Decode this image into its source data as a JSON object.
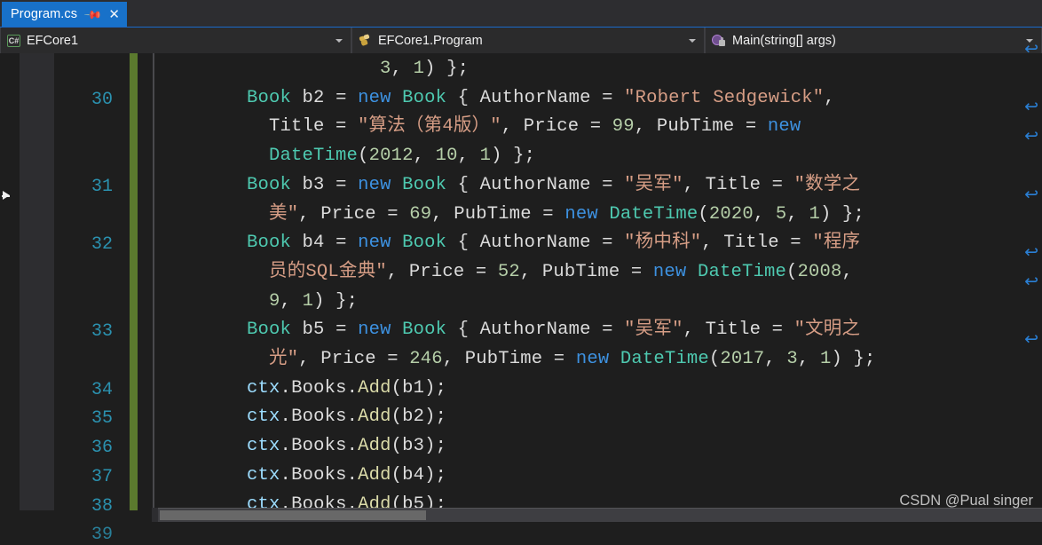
{
  "window": {
    "title": "Program.cs",
    "theme": "visual-studio-dark"
  },
  "tab": {
    "label": "Program.cs",
    "pin_icon": "pin-icon",
    "close_icon": "close-icon",
    "active_color": "#1871c9"
  },
  "navbar": {
    "project": {
      "label": "EFCore1",
      "icon": "csharp-project-icon"
    },
    "type": {
      "label": "EFCore1.Program",
      "icon": "class-icon"
    },
    "member": {
      "label": "Main(string[] args)",
      "icon": "method-private-icon"
    }
  },
  "editor": {
    "change_bar_color": "#5b7a2e",
    "linenumber_color": "#2b91af",
    "wrap_arrow_glyph": "↩",
    "line_numbers": [
      "30",
      "31",
      "32",
      "33",
      "34",
      "35",
      "36",
      "37",
      "38"
    ],
    "lines": [
      {
        "num": "",
        "text": "                 3, 1) };",
        "tokens": [
          {
            "t": "                    ",
            "c": "t-plain"
          },
          {
            "t": "3",
            "c": "t-num"
          },
          {
            "t": ", ",
            "c": "t-punct"
          },
          {
            "t": "1",
            "c": "t-num"
          },
          {
            "t": ") };",
            "c": "t-punct"
          }
        ]
      },
      {
        "num": "30",
        "text": "        Book b2 = new Book { AuthorName = \"Robert Sedgewick\",",
        "tokens": [
          {
            "t": "        ",
            "c": "t-plain"
          },
          {
            "t": "Book",
            "c": "t-type"
          },
          {
            "t": " b2 ",
            "c": "t-plain"
          },
          {
            "t": "= ",
            "c": "t-punct"
          },
          {
            "t": "new",
            "c": "t-kw"
          },
          {
            "t": " ",
            "c": "t-plain"
          },
          {
            "t": "Book",
            "c": "t-type"
          },
          {
            "t": " { AuthorName = ",
            "c": "t-plain"
          },
          {
            "t": "\"Robert Sedgewick\"",
            "c": "t-str"
          },
          {
            "t": ",",
            "c": "t-punct"
          }
        ]
      },
      {
        "num": "",
        "text": "          Title = \"算法（第4版）\", Price = 99, PubTime = new",
        "tokens": [
          {
            "t": "          Title = ",
            "c": "t-plain"
          },
          {
            "t": "\"算法（第4版）\"",
            "c": "t-str"
          },
          {
            "t": ", Price = ",
            "c": "t-plain"
          },
          {
            "t": "99",
            "c": "t-num"
          },
          {
            "t": ", PubTime = ",
            "c": "t-plain"
          },
          {
            "t": "new",
            "c": "t-kw"
          }
        ]
      },
      {
        "num": "",
        "text": "          DateTime(2012, 10, 1) };",
        "tokens": [
          {
            "t": "          ",
            "c": "t-plain"
          },
          {
            "t": "DateTime",
            "c": "t-type"
          },
          {
            "t": "(",
            "c": "t-punct"
          },
          {
            "t": "2012",
            "c": "t-num"
          },
          {
            "t": ", ",
            "c": "t-punct"
          },
          {
            "t": "10",
            "c": "t-num"
          },
          {
            "t": ", ",
            "c": "t-punct"
          },
          {
            "t": "1",
            "c": "t-num"
          },
          {
            "t": ") };",
            "c": "t-punct"
          }
        ]
      },
      {
        "num": "31",
        "text": "        Book b3 = new Book { AuthorName = \"吴军\", Title = \"数学之",
        "tokens": [
          {
            "t": "        ",
            "c": "t-plain"
          },
          {
            "t": "Book",
            "c": "t-type"
          },
          {
            "t": " b3 ",
            "c": "t-plain"
          },
          {
            "t": "= ",
            "c": "t-punct"
          },
          {
            "t": "new",
            "c": "t-kw"
          },
          {
            "t": " ",
            "c": "t-plain"
          },
          {
            "t": "Book",
            "c": "t-type"
          },
          {
            "t": " { AuthorName = ",
            "c": "t-plain"
          },
          {
            "t": "\"吴军\"",
            "c": "t-str"
          },
          {
            "t": ", Title = ",
            "c": "t-plain"
          },
          {
            "t": "\"数学之",
            "c": "t-str"
          }
        ]
      },
      {
        "num": "",
        "text": "          美\", Price = 69, PubTime = new DateTime(2020, 5, 1) };",
        "tokens": [
          {
            "t": "          ",
            "c": "t-plain"
          },
          {
            "t": "美\"",
            "c": "t-str"
          },
          {
            "t": ", Price = ",
            "c": "t-plain"
          },
          {
            "t": "69",
            "c": "t-num"
          },
          {
            "t": ", PubTime = ",
            "c": "t-plain"
          },
          {
            "t": "new",
            "c": "t-kw"
          },
          {
            "t": " ",
            "c": "t-plain"
          },
          {
            "t": "DateTime",
            "c": "t-type"
          },
          {
            "t": "(",
            "c": "t-punct"
          },
          {
            "t": "2020",
            "c": "t-num"
          },
          {
            "t": ", ",
            "c": "t-punct"
          },
          {
            "t": "5",
            "c": "t-num"
          },
          {
            "t": ", ",
            "c": "t-punct"
          },
          {
            "t": "1",
            "c": "t-num"
          },
          {
            "t": ") };",
            "c": "t-punct"
          }
        ]
      },
      {
        "num": "32",
        "text": "        Book b4 = new Book { AuthorName = \"杨中科\", Title = \"程序",
        "tokens": [
          {
            "t": "        ",
            "c": "t-plain"
          },
          {
            "t": "Book",
            "c": "t-type"
          },
          {
            "t": " b4 ",
            "c": "t-plain"
          },
          {
            "t": "= ",
            "c": "t-punct"
          },
          {
            "t": "new",
            "c": "t-kw"
          },
          {
            "t": " ",
            "c": "t-plain"
          },
          {
            "t": "Book",
            "c": "t-type"
          },
          {
            "t": " { AuthorName = ",
            "c": "t-plain"
          },
          {
            "t": "\"杨中科\"",
            "c": "t-str"
          },
          {
            "t": ", Title = ",
            "c": "t-plain"
          },
          {
            "t": "\"程序",
            "c": "t-str"
          }
        ]
      },
      {
        "num": "",
        "text": "          员的SQL金典\", Price = 52, PubTime = new DateTime(2008,",
        "tokens": [
          {
            "t": "          ",
            "c": "t-plain"
          },
          {
            "t": "员的SQL金典\"",
            "c": "t-str"
          },
          {
            "t": ", Price = ",
            "c": "t-plain"
          },
          {
            "t": "52",
            "c": "t-num"
          },
          {
            "t": ", PubTime = ",
            "c": "t-plain"
          },
          {
            "t": "new",
            "c": "t-kw"
          },
          {
            "t": " ",
            "c": "t-plain"
          },
          {
            "t": "DateTime",
            "c": "t-type"
          },
          {
            "t": "(",
            "c": "t-punct"
          },
          {
            "t": "2008",
            "c": "t-num"
          },
          {
            "t": ",",
            "c": "t-punct"
          }
        ]
      },
      {
        "num": "",
        "text": "          9, 1) };",
        "tokens": [
          {
            "t": "          ",
            "c": "t-plain"
          },
          {
            "t": "9",
            "c": "t-num"
          },
          {
            "t": ", ",
            "c": "t-punct"
          },
          {
            "t": "1",
            "c": "t-num"
          },
          {
            "t": ") };",
            "c": "t-punct"
          }
        ]
      },
      {
        "num": "33",
        "text": "        Book b5 = new Book { AuthorName = \"吴军\", Title = \"文明之",
        "tokens": [
          {
            "t": "        ",
            "c": "t-plain"
          },
          {
            "t": "Book",
            "c": "t-type"
          },
          {
            "t": " b5 ",
            "c": "t-plain"
          },
          {
            "t": "= ",
            "c": "t-punct"
          },
          {
            "t": "new",
            "c": "t-kw"
          },
          {
            "t": " ",
            "c": "t-plain"
          },
          {
            "t": "Book",
            "c": "t-type"
          },
          {
            "t": " { AuthorName = ",
            "c": "t-plain"
          },
          {
            "t": "\"吴军\"",
            "c": "t-str"
          },
          {
            "t": ", Title = ",
            "c": "t-plain"
          },
          {
            "t": "\"文明之",
            "c": "t-str"
          }
        ]
      },
      {
        "num": "",
        "text": "          光\", Price = 246, PubTime = new DateTime(2017, 3, 1) };",
        "tokens": [
          {
            "t": "          ",
            "c": "t-plain"
          },
          {
            "t": "光\"",
            "c": "t-str"
          },
          {
            "t": ", Price = ",
            "c": "t-plain"
          },
          {
            "t": "246",
            "c": "t-num"
          },
          {
            "t": ", PubTime = ",
            "c": "t-plain"
          },
          {
            "t": "new",
            "c": "t-kw"
          },
          {
            "t": " ",
            "c": "t-plain"
          },
          {
            "t": "DateTime",
            "c": "t-type"
          },
          {
            "t": "(",
            "c": "t-punct"
          },
          {
            "t": "2017",
            "c": "t-num"
          },
          {
            "t": ", ",
            "c": "t-punct"
          },
          {
            "t": "3",
            "c": "t-num"
          },
          {
            "t": ", ",
            "c": "t-punct"
          },
          {
            "t": "1",
            "c": "t-num"
          },
          {
            "t": ") };",
            "c": "t-punct"
          }
        ]
      },
      {
        "num": "34",
        "text": "        ctx.Books.Add(b1);",
        "tokens": [
          {
            "t": "        ",
            "c": "t-plain"
          },
          {
            "t": "ctx",
            "c": "t-var"
          },
          {
            "t": ".",
            "c": "t-punct"
          },
          {
            "t": "Books",
            "c": "t-plain"
          },
          {
            "t": ".",
            "c": "t-punct"
          },
          {
            "t": "Add",
            "c": "t-method"
          },
          {
            "t": "(",
            "c": "t-punct"
          },
          {
            "t": "b1",
            "c": "t-plain"
          },
          {
            "t": ");",
            "c": "t-punct"
          }
        ]
      },
      {
        "num": "35",
        "text": "        ctx.Books.Add(b2);",
        "tokens": [
          {
            "t": "        ",
            "c": "t-plain"
          },
          {
            "t": "ctx",
            "c": "t-var"
          },
          {
            "t": ".",
            "c": "t-punct"
          },
          {
            "t": "Books",
            "c": "t-plain"
          },
          {
            "t": ".",
            "c": "t-punct"
          },
          {
            "t": "Add",
            "c": "t-method"
          },
          {
            "t": "(",
            "c": "t-punct"
          },
          {
            "t": "b2",
            "c": "t-plain"
          },
          {
            "t": ");",
            "c": "t-punct"
          }
        ]
      },
      {
        "num": "36",
        "text": "        ctx.Books.Add(b3);",
        "tokens": [
          {
            "t": "        ",
            "c": "t-plain"
          },
          {
            "t": "ctx",
            "c": "t-var"
          },
          {
            "t": ".",
            "c": "t-punct"
          },
          {
            "t": "Books",
            "c": "t-plain"
          },
          {
            "t": ".",
            "c": "t-punct"
          },
          {
            "t": "Add",
            "c": "t-method"
          },
          {
            "t": "(",
            "c": "t-punct"
          },
          {
            "t": "b3",
            "c": "t-plain"
          },
          {
            "t": ");",
            "c": "t-punct"
          }
        ]
      },
      {
        "num": "37",
        "text": "        ctx.Books.Add(b4);",
        "tokens": [
          {
            "t": "        ",
            "c": "t-plain"
          },
          {
            "t": "ctx",
            "c": "t-var"
          },
          {
            "t": ".",
            "c": "t-punct"
          },
          {
            "t": "Books",
            "c": "t-plain"
          },
          {
            "t": ".",
            "c": "t-punct"
          },
          {
            "t": "Add",
            "c": "t-method"
          },
          {
            "t": "(",
            "c": "t-punct"
          },
          {
            "t": "b4",
            "c": "t-plain"
          },
          {
            "t": ");",
            "c": "t-punct"
          }
        ]
      },
      {
        "num": "38",
        "text": "        ctx.Books.Add(b5);",
        "tokens": [
          {
            "t": "        ",
            "c": "t-plain"
          },
          {
            "t": "ctx",
            "c": "t-var"
          },
          {
            "t": ".",
            "c": "t-punct"
          },
          {
            "t": "Books",
            "c": "t-plain"
          },
          {
            "t": ".",
            "c": "t-punct"
          },
          {
            "t": "Add",
            "c": "t-method"
          },
          {
            "t": "(",
            "c": "t-punct"
          },
          {
            "t": "b5",
            "c": "t-plain"
          },
          {
            "t": ");",
            "c": "t-punct"
          }
        ]
      }
    ]
  },
  "watermark": {
    "text": "CSDN @Pual singer"
  }
}
